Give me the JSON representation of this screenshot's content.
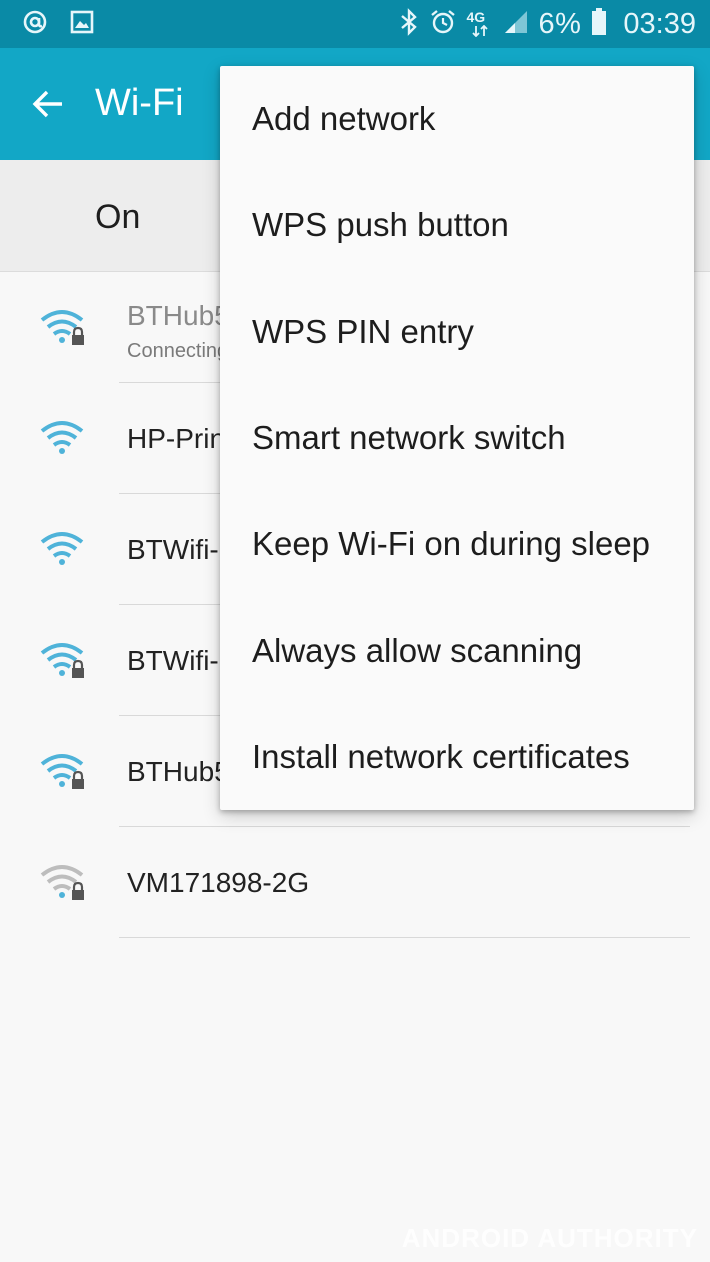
{
  "status_bar": {
    "left_icons": [
      "at-sign-icon",
      "image-icon"
    ],
    "right_icons": [
      "bluetooth-icon",
      "alarm-icon",
      "network-4g-icon",
      "signal-icon",
      "battery-icon"
    ],
    "network_type": "4G",
    "battery_percent": "6%",
    "time": "03:39"
  },
  "app_bar": {
    "title": "Wi-Fi",
    "back_icon": "arrow-back-icon"
  },
  "toggle": {
    "label": "On"
  },
  "networks": [
    {
      "name": "BTHub5",
      "status": "Connecting",
      "secured": true
    },
    {
      "name": "HP-Print",
      "status": "",
      "secured": false
    },
    {
      "name": "BTWifi-",
      "status": "",
      "secured": false
    },
    {
      "name": "BTWifi-",
      "status": "",
      "secured": true
    },
    {
      "name": "BTHub5",
      "status": "",
      "secured": true
    },
    {
      "name": "VM171898-2G",
      "status": "",
      "secured": true
    }
  ],
  "menu": {
    "items": [
      "Add network",
      "WPS push button",
      "WPS PIN entry",
      "Smart network switch",
      "Keep Wi-Fi on during sleep",
      "Always allow scanning",
      "Install network certificates"
    ]
  },
  "colors": {
    "status_bar": "#0a8aa6",
    "app_bar": "#12a7c6",
    "wifi_icon": "#4fb3d9"
  },
  "watermark": "ANDROID AUTHORITY"
}
